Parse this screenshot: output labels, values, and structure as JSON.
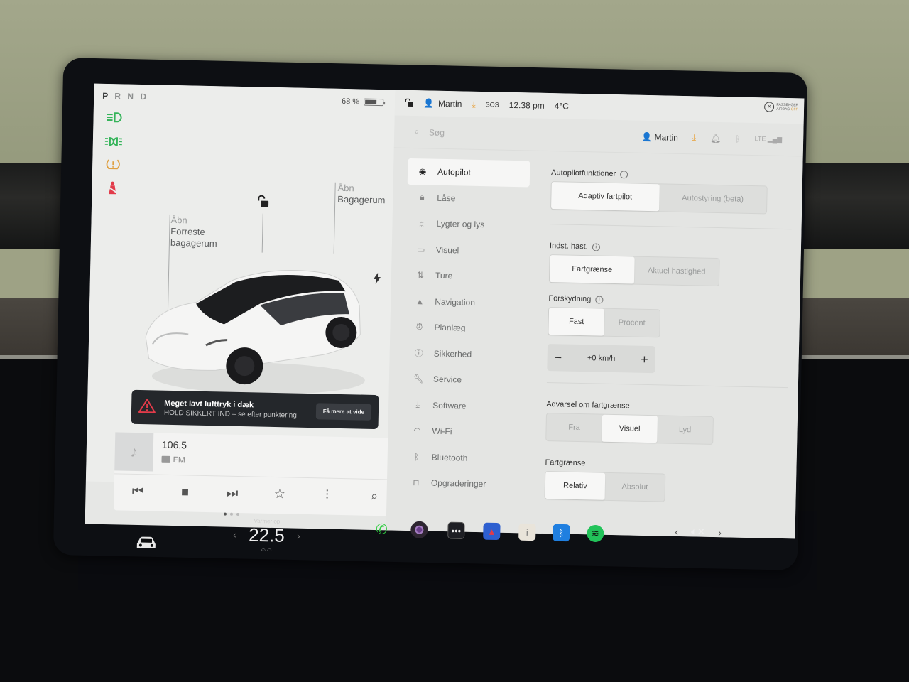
{
  "drive": {
    "gears": [
      "P",
      "R",
      "N",
      "D"
    ],
    "battery_percent_label": "68 %",
    "battery_level": 0.68
  },
  "telltales": [
    {
      "icon": "low-beam-icon",
      "color": "#35b45a"
    },
    {
      "icon": "parking-lights-icon",
      "color": "#35b45a"
    },
    {
      "icon": "tire-pressure-warning-icon",
      "color": "#e0a040"
    },
    {
      "icon": "seatbelt-warning-icon",
      "color": "#e23b4a"
    }
  ],
  "car": {
    "frunk": {
      "action": "Åbn",
      "label_line1": "Forreste",
      "label_line2": "bagagerum"
    },
    "trunk": {
      "action": "Åbn",
      "label": "Bagagerum"
    },
    "lock_icon": "unlock-icon",
    "charge_icon": "lightning-icon"
  },
  "alert": {
    "title": "Meget lavt lufttryk i dæk",
    "message": "HOLD SIKKERT IND – se efter punktering",
    "button": "Få mere at vide",
    "icon": "warning-triangle-icon",
    "color": "#e23b4a"
  },
  "media": {
    "station": "106.5",
    "band": "FM",
    "controls": [
      "previous-icon",
      "stop-icon",
      "next-icon",
      "favorite-icon",
      "equalizer-icon",
      "search-icon"
    ],
    "page_dots": 3,
    "active_dot": 0
  },
  "status_bar": {
    "user": "Martin",
    "sos": "SOS",
    "time": "12.38 pm",
    "temperature": "4°C",
    "airbag_line1": "PASSENGER",
    "airbag_line2": "AIRBAG",
    "airbag_state": "OFF"
  },
  "settings": {
    "search_placeholder": "Søg",
    "profile": "Martin",
    "nav": [
      {
        "label": "Autopilot",
        "icon": "steering-wheel-icon",
        "active": true
      },
      {
        "label": "Låse",
        "icon": "lock-icon"
      },
      {
        "label": "Lygter og lys",
        "icon": "light-icon"
      },
      {
        "label": "Visuel",
        "icon": "display-icon"
      },
      {
        "label": "Ture",
        "icon": "trips-icon"
      },
      {
        "label": "Navigation",
        "icon": "navigation-icon"
      },
      {
        "label": "Planlæg",
        "icon": "schedule-icon"
      },
      {
        "label": "Sikkerhed",
        "icon": "safety-icon"
      },
      {
        "label": "Service",
        "icon": "wrench-icon"
      },
      {
        "label": "Software",
        "icon": "download-icon"
      },
      {
        "label": "Wi-Fi",
        "icon": "wifi-icon"
      },
      {
        "label": "Bluetooth",
        "icon": "bluetooth-icon"
      },
      {
        "label": "Opgraderinger",
        "icon": "shopping-bag-icon"
      }
    ],
    "autopilot_features": {
      "label": "Autopilotfunktioner",
      "options": [
        "Adaptiv fartpilot",
        "Autostyring (beta)"
      ],
      "selected": 0
    },
    "set_speed": {
      "label": "Indst. hast.",
      "options": [
        "Fartgrænse",
        "Aktuel hastighed"
      ],
      "selected": 0
    },
    "offset": {
      "label": "Forskydning",
      "options": [
        "Fast",
        "Procent"
      ],
      "selected": 0,
      "value": "+0 km/h"
    },
    "speed_warning": {
      "label": "Advarsel om fartgrænse",
      "options": [
        "Fra",
        "Visuel",
        "Lyd"
      ],
      "selected": 1
    },
    "speed_limit": {
      "label": "Fartgrænse",
      "options": [
        "Relativ",
        "Absolut"
      ],
      "selected": 0
    }
  },
  "taskbar": {
    "climate_status": "Varmer op",
    "temperature": "22.5",
    "apps": [
      {
        "name": "phone-icon",
        "color": "#2ecc40"
      },
      {
        "name": "camera-icon",
        "color": "#6a3f8a"
      },
      {
        "name": "more-apps-icon",
        "color": "#2a2a2f"
      },
      {
        "name": "navigation-app-icon",
        "color": "#2d5fd0"
      },
      {
        "name": "manual-icon",
        "color": "#e9e4da"
      },
      {
        "name": "bluetooth-app-icon",
        "color": "#1f7fe0"
      },
      {
        "name": "spotify-icon",
        "color": "#22c35a"
      }
    ],
    "volume": "muted"
  }
}
